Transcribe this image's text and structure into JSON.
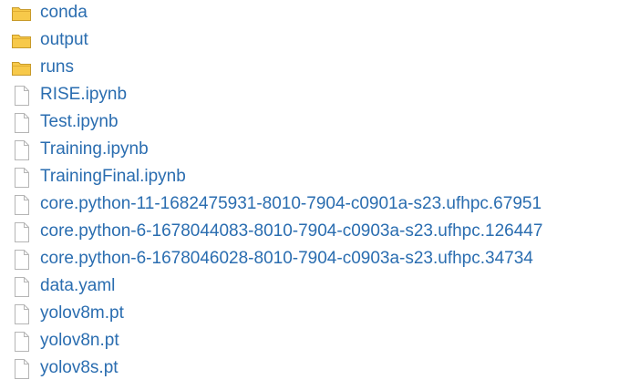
{
  "file_browser": {
    "items": [
      {
        "type": "folder",
        "name": "conda",
        "icon": "folder-icon"
      },
      {
        "type": "folder",
        "name": "output",
        "icon": "folder-icon"
      },
      {
        "type": "folder",
        "name": "runs",
        "icon": "folder-icon"
      },
      {
        "type": "file",
        "name": "RISE.ipynb",
        "icon": "file-icon"
      },
      {
        "type": "file",
        "name": "Test.ipynb",
        "icon": "file-icon"
      },
      {
        "type": "file",
        "name": "Training.ipynb",
        "icon": "file-icon"
      },
      {
        "type": "file",
        "name": "TrainingFinal.ipynb",
        "icon": "file-icon"
      },
      {
        "type": "file",
        "name": "core.python-11-1682475931-8010-7904-c0901a-s23.ufhpc.67951",
        "icon": "file-icon"
      },
      {
        "type": "file",
        "name": "core.python-6-1678044083-8010-7904-c0903a-s23.ufhpc.126447",
        "icon": "file-icon"
      },
      {
        "type": "file",
        "name": "core.python-6-1678046028-8010-7904-c0903a-s23.ufhpc.34734",
        "icon": "file-icon"
      },
      {
        "type": "file",
        "name": "data.yaml",
        "icon": "file-icon"
      },
      {
        "type": "file",
        "name": "yolov8m.pt",
        "icon": "file-icon"
      },
      {
        "type": "file",
        "name": "yolov8n.pt",
        "icon": "file-icon"
      },
      {
        "type": "file",
        "name": "yolov8s.pt",
        "icon": "file-icon"
      }
    ]
  },
  "colors": {
    "link": "#2a6db0",
    "folder_fill": "#f7c94a",
    "folder_stroke": "#c79a2a",
    "file_fill": "#ffffff",
    "file_stroke": "#b5b5b5"
  }
}
